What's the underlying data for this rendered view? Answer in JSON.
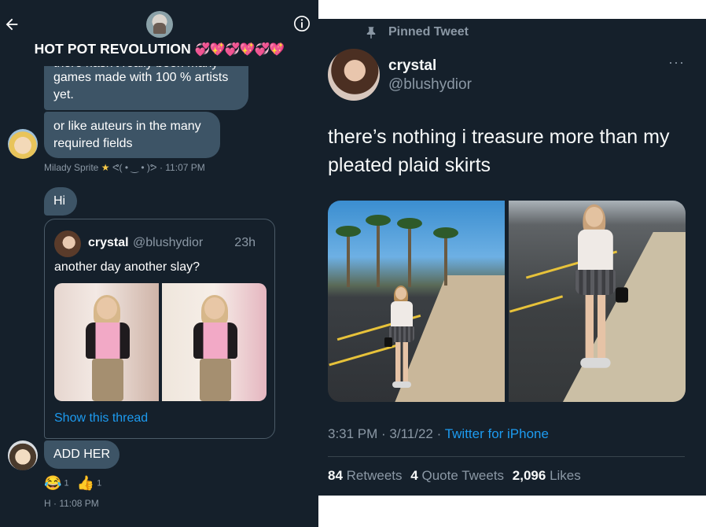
{
  "chat": {
    "group_title": "HOT POT REVOLUTION",
    "group_title_emoji": "💞💖💞💖💞💖",
    "messages": {
      "m1_overflow": "there hasn't really been many",
      "m1_text": "games made with 100 % artists yet.",
      "m2_text": "or like auteurs in the many required fields",
      "m2_meta": "Milady Sprite",
      "m2_meta_kaomoji": "ᕙ( • ‿ • )ᕗ · 11:07 PM",
      "hi_text": "Hi",
      "add_text": "ADD HER",
      "last_meta": "H · 11:08 PM"
    },
    "quote": {
      "name": "crystal",
      "handle": "@blushydior",
      "time": "23h",
      "text": "another day another slay?",
      "show_thread": "Show this thread"
    },
    "reactions": [
      {
        "emoji": "😂",
        "count": "1"
      },
      {
        "emoji": "👍",
        "count": "1"
      }
    ],
    "icons": {
      "back": "arrow-left-icon",
      "info": "info-icon"
    }
  },
  "tweet": {
    "pinned_label": "Pinned Tweet",
    "display_name": "crystal",
    "handle": "@blushydior",
    "more": "···",
    "text": "there’s nothing i treasure more than my pleated plaid skirts",
    "time": "3:31 PM · 3/11/22 · ",
    "source": "Twitter for iPhone",
    "stats": {
      "retweets_count": "84",
      "retweets_label": "Retweets",
      "quotes_count": "4",
      "quotes_label": "Quote Tweets",
      "likes_count": "2,096",
      "likes_label": "Likes"
    }
  },
  "colors": {
    "background": "#15202b",
    "bubble": "#3d5466",
    "accent": "#1d9bf0",
    "muted": "#8b98a5"
  }
}
